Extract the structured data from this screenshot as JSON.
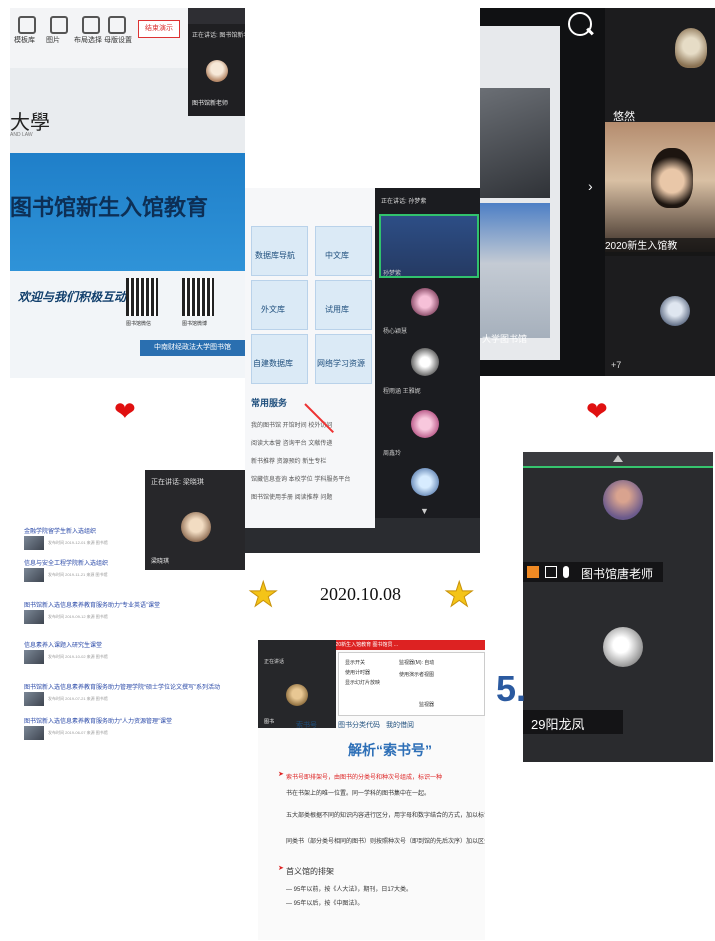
{
  "collage": {
    "date": "2020.10.08",
    "decorations": {
      "heart": "❤",
      "star": "★"
    }
  },
  "slide_photo": {
    "toolbar_labels": [
      "模板库",
      "图片",
      "布局选择",
      "母版设置"
    ],
    "red_button": "结束演示",
    "speaking": "正在讲话: 图书馆新老师",
    "speaker_name": "图书馆新老师",
    "university": "大學",
    "university_sub": "AND LAW",
    "title": "图书馆新生入馆教育",
    "welcome": "欢迎与我们积极互动！",
    "qr_labels": [
      "图书馆微信",
      "图书馆微博"
    ],
    "footer": "中南财经政法大学图书馆"
  },
  "video_call": {
    "name1": "悠然",
    "video_caption": "2020新生入馆教",
    "library_caption": "大学图书馆",
    "more": "+7"
  },
  "tablet": {
    "tiles": [
      "数据库导航",
      "中文库",
      "外文库",
      "试用库",
      "自建数据库",
      "网络学习资源"
    ],
    "services_title": "常用服务",
    "services_rows": [
      "我的图书馆   开馆时间   校外访问",
      "阅读大本营   咨询平台   文献传递",
      "新书推荐     资源预约   新生专栏",
      "馆藏信息查询   本校学位   学科服务平台",
      "图书馆使用手册   阅读推荐   问题"
    ],
    "speaking": "正在讲话: 孙梦紫",
    "participants": [
      "孙梦紫",
      "杨心颖慧",
      "程雨涵 王雅妮",
      "周鑫玲"
    ]
  },
  "news_list": {
    "speaking": "正在讲话: 梁晓琪",
    "caller_name": "梁晓琪",
    "items": [
      {
        "title": "金融学院留学生新入选组织",
        "meta": "发布时间 2019-12-01  来源 图书馆"
      },
      {
        "title": "信息与安全工程学院新入选组织",
        "meta": "发布时间 2019-11-21  来源 图书馆"
      },
      {
        "title": "图书馆新入选信息素养教育服务助力“专业英语”课堂",
        "meta": "发布时间 2019-09-12  来源 图书馆"
      },
      {
        "title": "信息素养入课题入研究生课堂",
        "meta": "发布时间 2019-10-02  来源 图书馆"
      },
      {
        "title": "图书馆新入选信息素养教育服务助力管理学院“硕士学位论文撰写”系列活动",
        "meta": "发布时间 2019-07-21  来源 图书馆"
      },
      {
        "title": "图书馆新入选信息素养教育服务助力“人力资源管理”课堂",
        "meta": "发布时间 2019-06-07  来源 图书馆"
      }
    ]
  },
  "call_list": {
    "host_name": "图书馆唐老师",
    "participant": "29阳龙凤"
  },
  "lesson_slide": {
    "top_bar": "2020新生入馆教育   图书馆员  ...",
    "cam_speaking": "正在讲话",
    "cam_name": "图书",
    "dialog_lines": [
      "显示开关",
      "使用计时器",
      "显示幻灯片放映",
      "监视器(M): 自动",
      "使用演示者视图"
    ],
    "dialog_section": "监视器",
    "tabs": [
      "索书号",
      "图书分类代码",
      "我的借阅"
    ],
    "heading": "解析“索书号”",
    "paragraphs": [
      "索书号即排架号，由图书的分类号和种次号组成，标识一种",
      "书在书架上的唯一位置。同一学科的图书集中在一起。",
      "五大部类根据不同的知识内容进行区分，用字母和数字结合的方式，加以标识。",
      "同类书（部分类号相同的图书）则按照种次号（即到馆的先后次序）加以区分。",
      "首义馆的排架",
      "— 95年以前，按《人大法》，期刊，日17大类。",
      "— 95年以后，按《中图法》。"
    ],
    "big_number": "5."
  }
}
